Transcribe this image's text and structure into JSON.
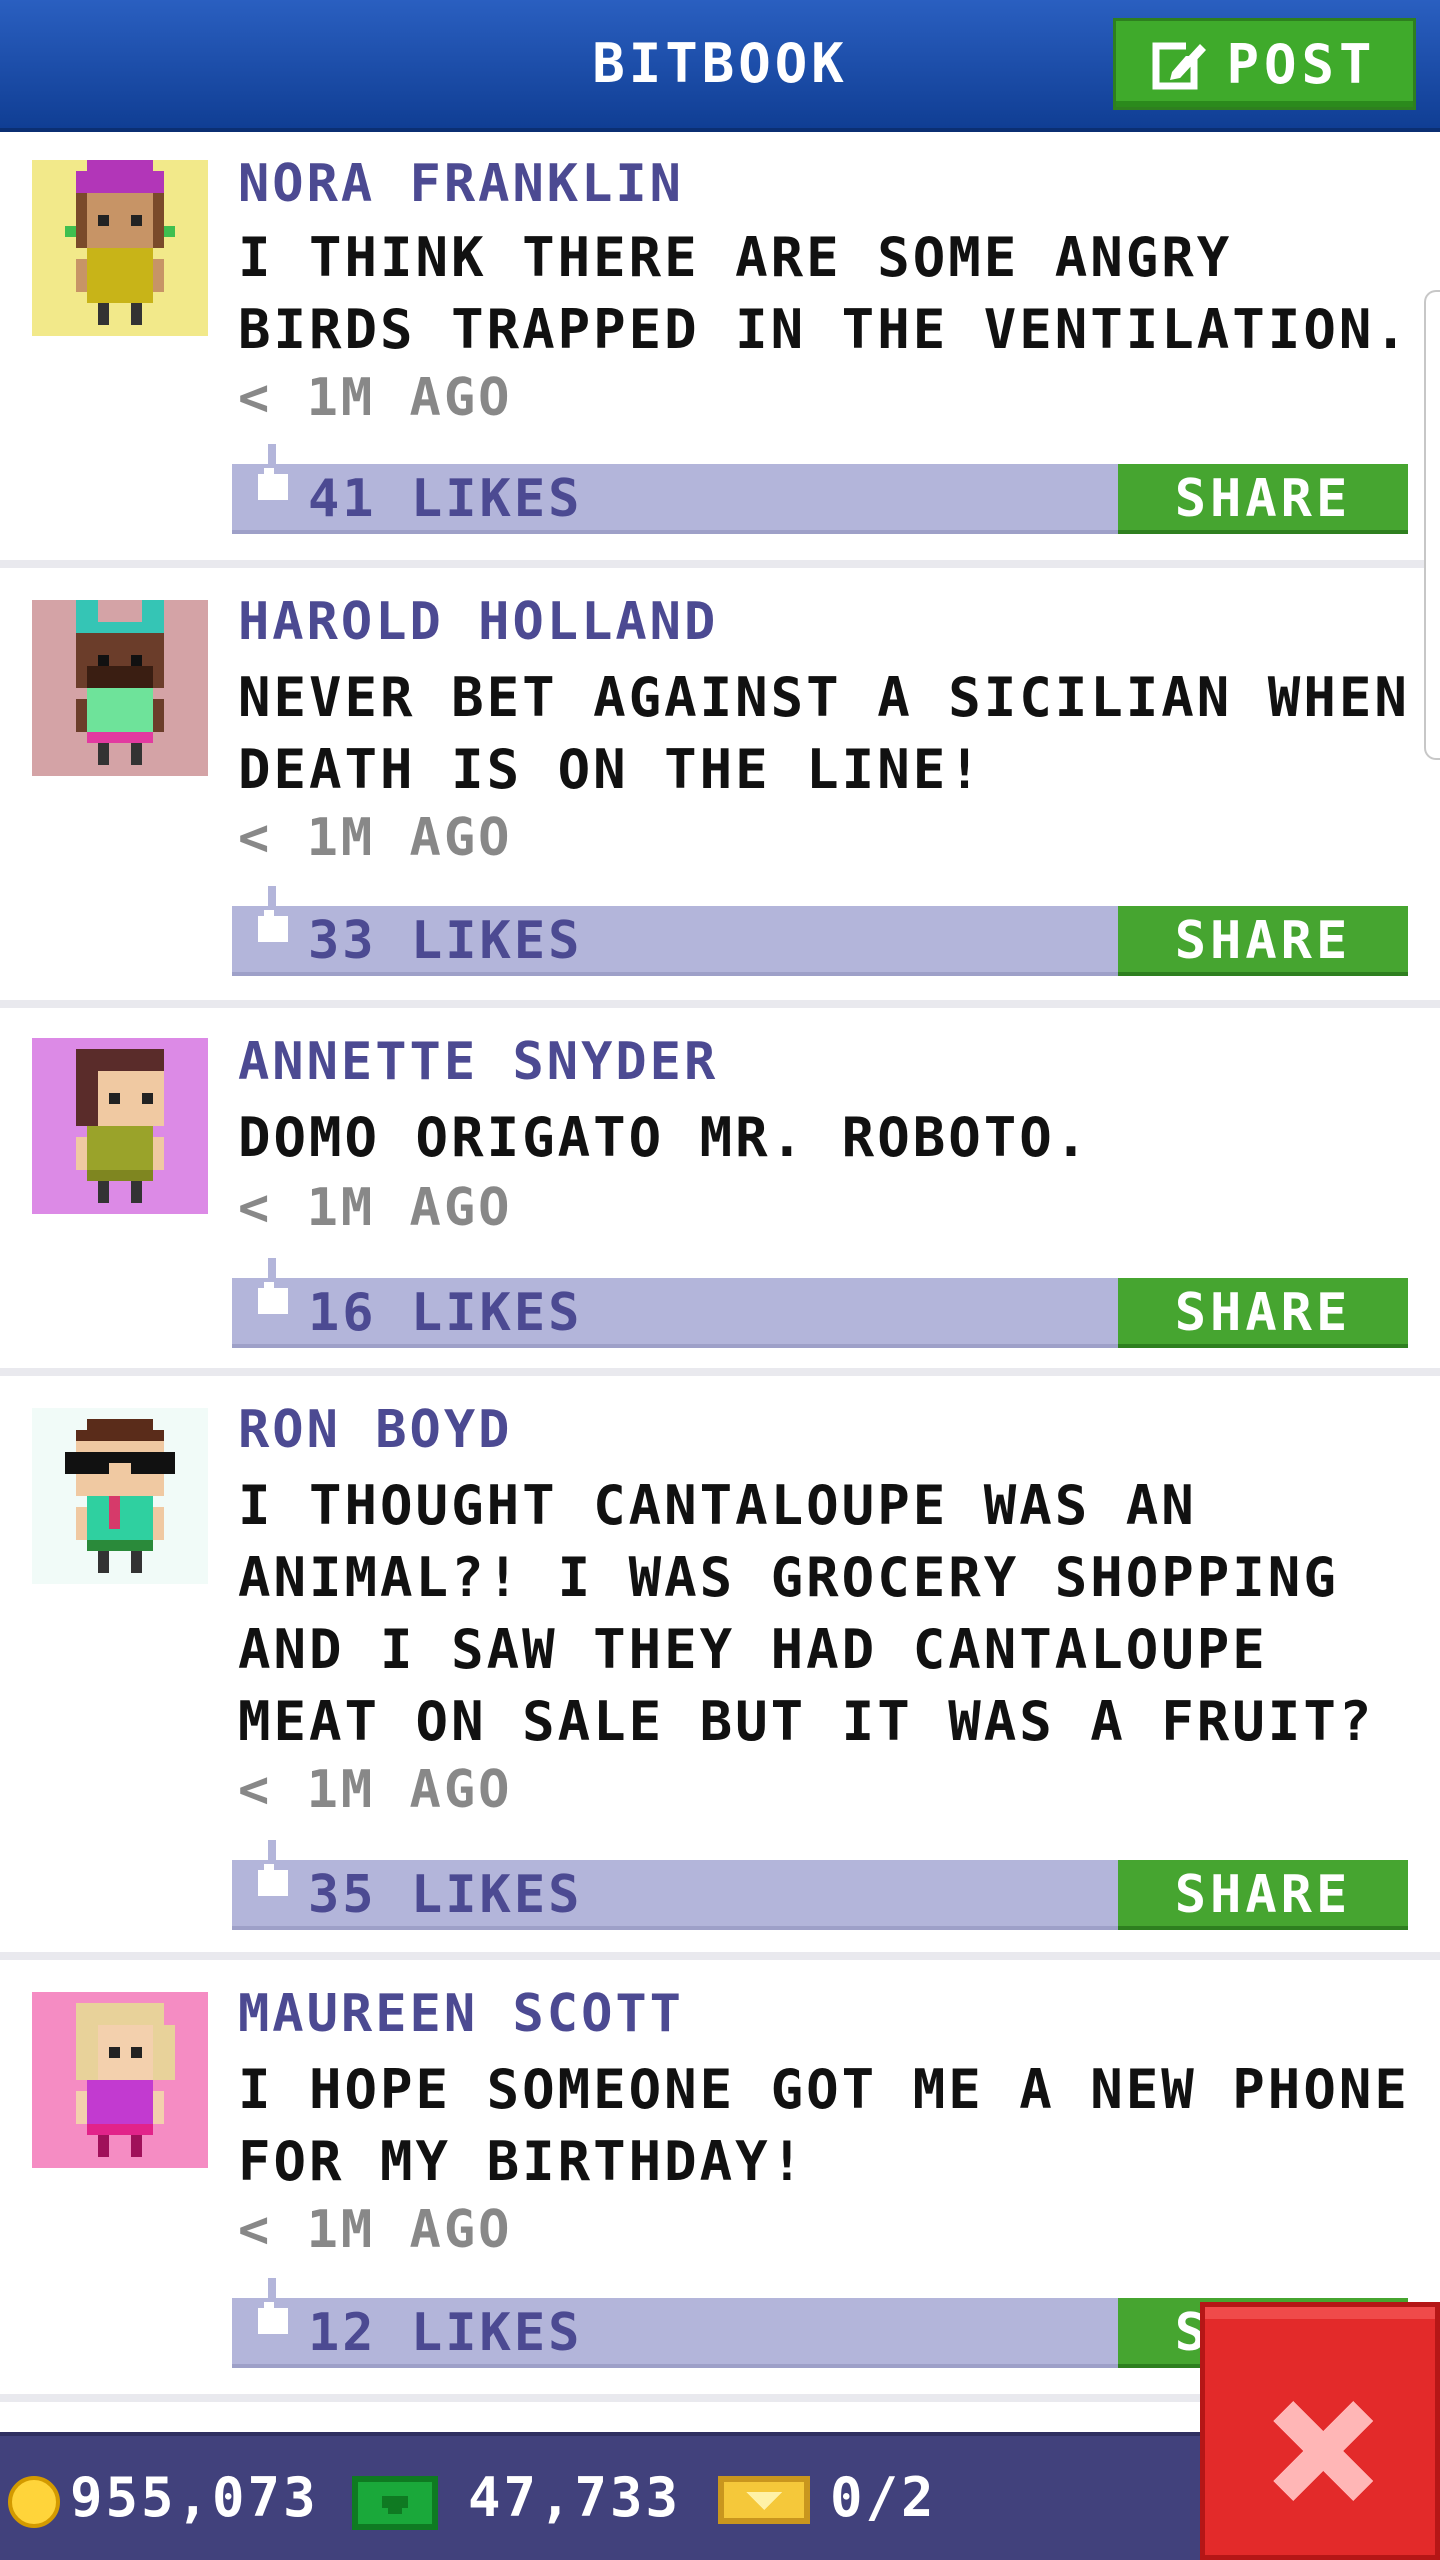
{
  "header": {
    "title": "BITBOOK",
    "post_label": "POST"
  },
  "posts": [
    {
      "author": "NORA FRANKLIN",
      "text": "I THINK THERE ARE SOME ANGRY BIRDS TRAPPED IN THE VENTILATION.",
      "time": "< 1M AGO",
      "likes": "41 LIKES",
      "share_label": "SHARE",
      "avatar_bg": "#f2e98a"
    },
    {
      "author": "HAROLD HOLLAND",
      "text": "NEVER BET AGAINST A SICILIAN WHEN DEATH IS ON THE LINE!",
      "time": "< 1M AGO",
      "likes": "33 LIKES",
      "share_label": "SHARE",
      "avatar_bg": "#d4a3a6"
    },
    {
      "author": "ANNETTE SNYDER",
      "text": "DOMO ORIGATO MR. ROBOTO.",
      "time": "< 1M AGO",
      "likes": "16 LIKES",
      "share_label": "SHARE",
      "avatar_bg": "#dc8ae6"
    },
    {
      "author": "RON BOYD",
      "text": "I THOUGHT CANTALOUPE WAS AN ANIMAL?! I WAS GROCERY SHOPPING AND I SAW THEY HAD CANTALOUPE MEAT ON SALE BUT IT WAS A FRUIT?",
      "time": "< 1M AGO",
      "likes": "35 LIKES",
      "share_label": "SHARE",
      "avatar_bg": "#f1fbf8"
    },
    {
      "author": "MAUREEN SCOTT",
      "text": "I HOPE SOMEONE GOT ME A NEW PHONE FOR MY BIRTHDAY!",
      "time": "< 1M AGO",
      "likes": "12 LIKES",
      "share_label": "SHARE",
      "avatar_bg": "#f58cc3"
    }
  ],
  "status_bar": {
    "coins": "955,073",
    "bux": "47,733",
    "vip": "0/2"
  },
  "colors": {
    "header": "#1a4ea8",
    "share_green": "#46a530",
    "like_bar": "#b3b5da",
    "author": "#4c4a92",
    "close_red": "#e32a2a"
  }
}
